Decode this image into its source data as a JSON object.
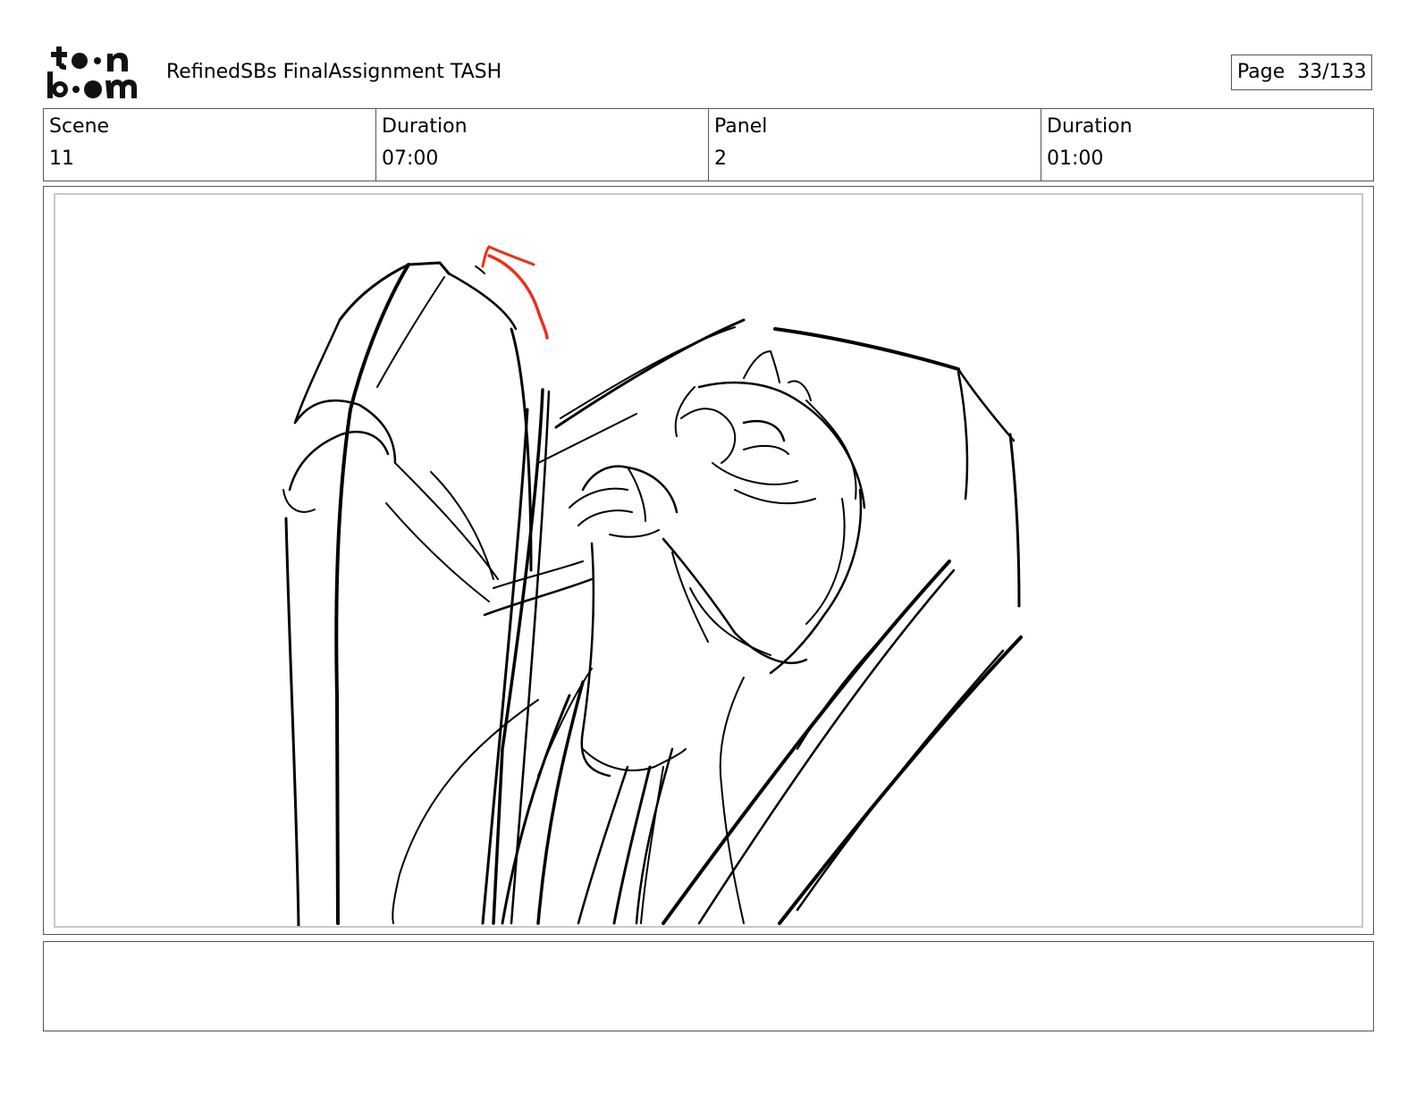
{
  "header": {
    "logo_icon": "toon-boom-logo",
    "title": "RefinedSBs FinalAssignment TASH",
    "page_label": "Page",
    "page_value": "33/133"
  },
  "info": {
    "scene_label": "Scene",
    "scene_value": "11",
    "scene_duration_label": "Duration",
    "scene_duration_value": "07:00",
    "panel_label": "Panel",
    "panel_value": "2",
    "panel_duration_label": "Duration",
    "panel_duration_value": "01:00"
  },
  "panel": {
    "sketch_color": "#000000",
    "arrow_color": "#e8321c",
    "arrow_icon": "rotation-arrow-icon"
  },
  "notes": {
    "text": ""
  }
}
